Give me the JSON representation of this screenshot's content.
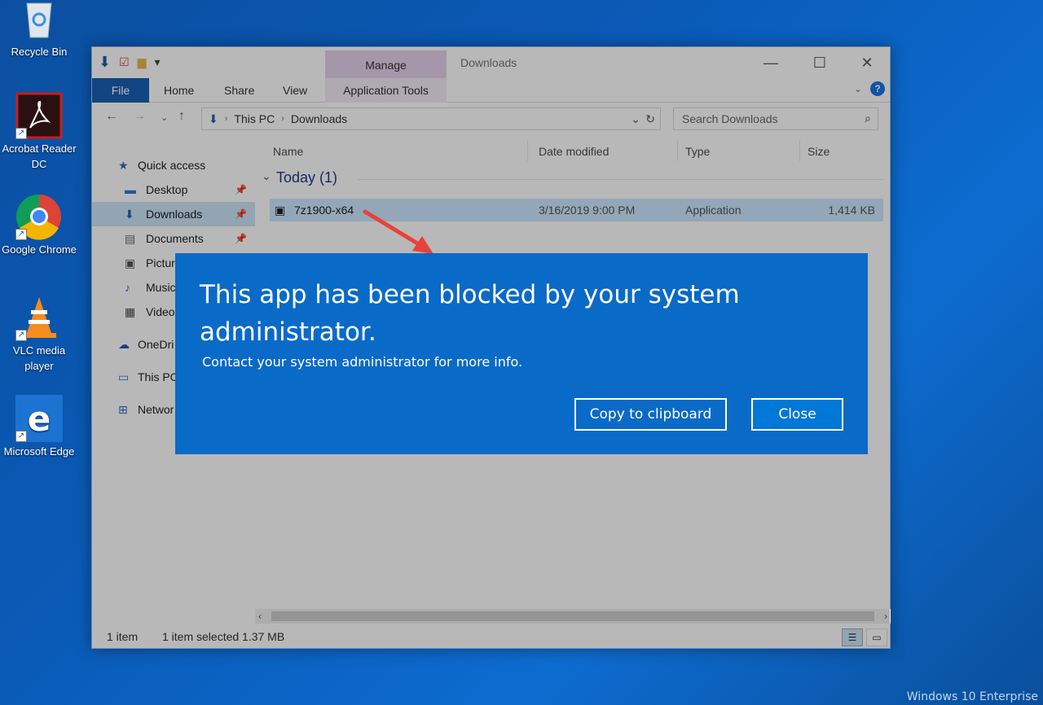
{
  "desktop": {
    "icons": [
      {
        "label": "Recycle Bin"
      },
      {
        "label": "Acrobat Reader DC"
      },
      {
        "label": "Google Chrome"
      },
      {
        "label": "VLC media player"
      },
      {
        "label": "Microsoft Edge"
      }
    ],
    "watermark": "Windows 10 Enterprise"
  },
  "explorer": {
    "title": "Downloads",
    "manage_tab": "Manage",
    "ribbon_tabs": [
      "File",
      "Home",
      "Share",
      "View",
      "Application Tools"
    ],
    "address": {
      "segments": [
        "This PC",
        "Downloads"
      ]
    },
    "search_placeholder": "Search Downloads",
    "nav": [
      {
        "label": "Quick access",
        "icon": "star-icon"
      },
      {
        "label": "Desktop",
        "icon": "desktop-icon",
        "pinned": true
      },
      {
        "label": "Downloads",
        "icon": "download-arrow-icon",
        "pinned": true,
        "selected": true
      },
      {
        "label": "Documents",
        "icon": "document-icon",
        "pinned": true
      },
      {
        "label": "Pictur",
        "icon": "pictures-icon"
      },
      {
        "label": "Music",
        "icon": "music-note-icon"
      },
      {
        "label": "Video",
        "icon": "video-icon"
      },
      {
        "label": "OneDri",
        "icon": "cloud-icon"
      },
      {
        "label": "This PC",
        "icon": "computer-icon"
      },
      {
        "label": "Networ",
        "icon": "network-icon"
      }
    ],
    "columns": [
      "Name",
      "Date modified",
      "Type",
      "Size"
    ],
    "group": "Today (1)",
    "files": [
      {
        "name": "7z1900-x64",
        "date": "3/16/2019 9:00 PM",
        "type": "Application",
        "size": "1,414 KB"
      }
    ],
    "status": {
      "count": "1 item",
      "selected": "1 item selected  1.37 MB"
    }
  },
  "dialog": {
    "title": "This app has been blocked by your system administrator.",
    "message": "Contact your system administrator for more info.",
    "copy_button": "Copy to clipboard",
    "close_button": "Close",
    "color": "#0a6ac8"
  }
}
